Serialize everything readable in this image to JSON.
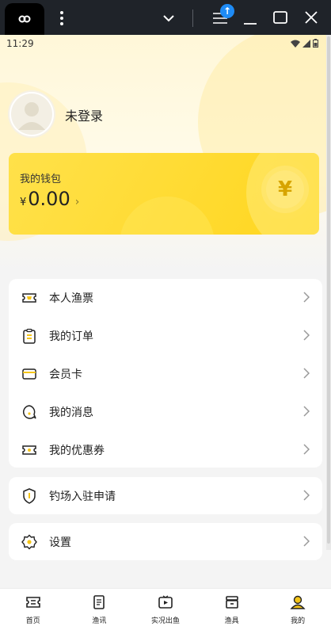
{
  "window": {
    "badge_arrow": "↑"
  },
  "status_bar": {
    "time": "11:29"
  },
  "profile": {
    "login_text": "未登录"
  },
  "wallet": {
    "label": "我的钱包",
    "currency": "¥",
    "amount": "0.00",
    "coin_symbol": "¥",
    "arrow": "›"
  },
  "menu_primary": [
    {
      "label": "本人渔票",
      "icon": "ticket-icon"
    },
    {
      "label": "我的订单",
      "icon": "clipboard-icon"
    },
    {
      "label": "会员卡",
      "icon": "card-icon"
    },
    {
      "label": "我的消息",
      "icon": "chat-bubble-icon"
    },
    {
      "label": "我的优惠券",
      "icon": "coupon-icon"
    }
  ],
  "menu_secondary": [
    {
      "label": "钓场入驻申请",
      "icon": "shield-icon"
    }
  ],
  "menu_settings": [
    {
      "label": "设置",
      "icon": "settings-icon"
    }
  ],
  "bottom_nav": [
    {
      "label": "首页",
      "icon": "home-ticket-icon",
      "active": false
    },
    {
      "label": "渔讯",
      "icon": "news-icon",
      "active": false
    },
    {
      "label": "实况出鱼",
      "icon": "live-video-icon",
      "active": false
    },
    {
      "label": "渔具",
      "icon": "store-icon",
      "active": false
    },
    {
      "label": "我的",
      "icon": "person-icon",
      "active": true
    }
  ],
  "colors": {
    "accent": "#ffd61f",
    "active_icon": "#f5c518"
  }
}
